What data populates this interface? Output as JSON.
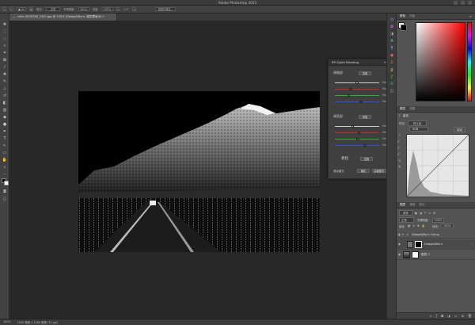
{
  "app": {
    "title": "Adobe Photoshop 2021"
  },
  "options_bar": {
    "mode_value": "正常",
    "opacity_label": "不透明度:",
    "opacity_value": "100%",
    "flow_label": "模式:",
    "flow_value": "正常",
    "smooth_label": "流量:",
    "smooth_value": "100%",
    "select_subject": "选择并遮住..."
  },
  "document_tab": {
    "label": "chile-5058788_1920.jpg @ 100% (Dodge&Burn, 图层蒙版/8) *"
  },
  "plugin_panel": {
    "title": "RPI Quick Blending",
    "section1_label": "调暗部",
    "section1_button": "重置",
    "section2_label": "调亮部",
    "section2_button": "重置",
    "max_label": "Max",
    "tutorial_label": "教程",
    "tutorial_button": "设置",
    "bottom_left_label": "混合模式",
    "bottom_btn1": "确定",
    "bottom_btn2": "高级模式",
    "sliders_top": [
      {
        "color": "#cfcfcf",
        "value": 0.5
      },
      {
        "color": "#d22727",
        "value": 0.35
      },
      {
        "color": "#25b525",
        "value": 0.3
      },
      {
        "color": "#3050e0",
        "value": 0.6
      }
    ],
    "sliders_bottom": [
      {
        "color": "#cfcfcf",
        "value": 0.4
      },
      {
        "color": "#d22727",
        "value": 0.55
      },
      {
        "color": "#25b525",
        "value": 0.52
      },
      {
        "color": "#3050e0",
        "value": 0.7
      }
    ]
  },
  "color_panel": {
    "tabs": [
      "颜色",
      "色板"
    ],
    "base_hue": "#ff0000"
  },
  "properties_panel": {
    "tabs": [
      "属性",
      "调整"
    ],
    "header": "曲线",
    "preset_label": "预设:",
    "preset_value": "默认值",
    "channel_value": "RGB",
    "auto_label": "自动"
  },
  "layers_panel": {
    "tabs": [
      "图层",
      "通道",
      "路径"
    ],
    "kind_label": "类型",
    "blend_mode": "正常",
    "opacity_label": "不透明度:",
    "opacity_value": "100%",
    "lock_label": "锁定:",
    "fill_label": "填充:",
    "fill_value": "100%",
    "layers": [
      {
        "name": "Dodge&Burn Group",
        "kind": "group"
      },
      {
        "name": "Dodge&Burn",
        "kind": "layer"
      },
      {
        "name": "图层 0",
        "kind": "image"
      }
    ]
  },
  "status_bar": {
    "zoom": "100%",
    "dimensions": "1920 像素 x 1280 像素 (72 ppi)"
  }
}
